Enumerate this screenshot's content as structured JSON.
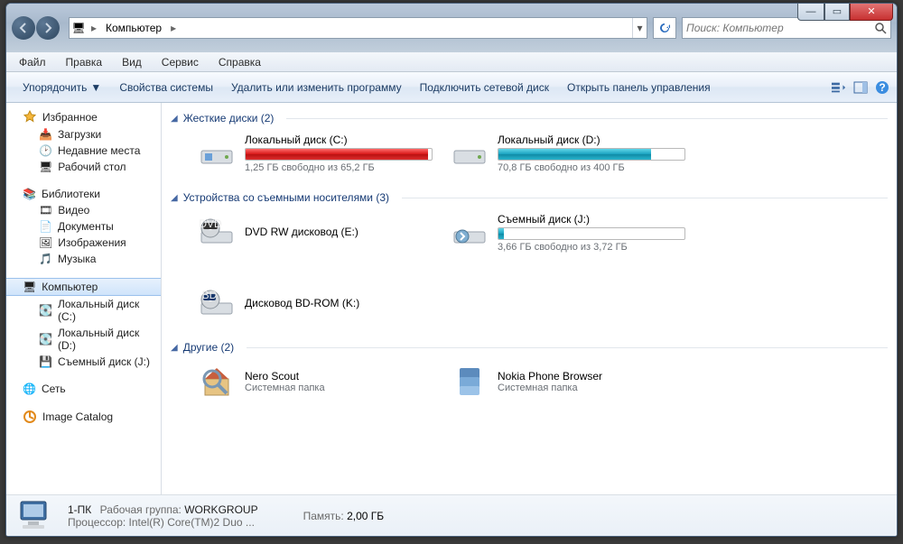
{
  "address": {
    "crumb_icon": "🖥",
    "crumb_text": "Компьютер"
  },
  "search": {
    "placeholder": "Поиск: Компьютер"
  },
  "menu": {
    "items": [
      "Файл",
      "Правка",
      "Вид",
      "Сервис",
      "Справка"
    ]
  },
  "toolbar": {
    "organize": "Упорядочить",
    "sys_props": "Свойства системы",
    "uninstall": "Удалить или изменить программу",
    "map_drive": "Подключить сетевой диск",
    "ctrl_panel": "Открыть панель управления"
  },
  "sidebar": {
    "favorites": {
      "head": "Избранное",
      "items": [
        "Загрузки",
        "Недавние места",
        "Рабочий стол"
      ]
    },
    "libraries": {
      "head": "Библиотеки",
      "items": [
        "Видео",
        "Документы",
        "Изображения",
        "Музыка"
      ]
    },
    "computer": {
      "head": "Компьютер",
      "items": [
        "Локальный диск (C:)",
        "Локальный диск (D:)",
        "Съемный диск (J:)"
      ]
    },
    "network": {
      "head": "Сеть"
    },
    "image_catalog": {
      "head": "Image Catalog"
    }
  },
  "sections": {
    "hdd": {
      "title": "Жесткие диски (2)"
    },
    "removable": {
      "title": "Устройства со съемными носителями (3)"
    },
    "other": {
      "title": "Другие (2)"
    }
  },
  "drives": {
    "c": {
      "name": "Локальный диск (C:)",
      "sub": "1,25 ГБ свободно из 65,2 ГБ",
      "fill_pct": 98,
      "fill_color": "red"
    },
    "d": {
      "name": "Локальный диск (D:)",
      "sub": "70,8 ГБ свободно из 400 ГБ",
      "fill_pct": 82,
      "fill_color": "teal"
    }
  },
  "removable": {
    "dvd": {
      "name": "DVD RW дисковод (E:)"
    },
    "usb": {
      "name": "Съемный диск (J:)",
      "sub": "3,66 ГБ свободно из 3,72 ГБ",
      "fill_pct": 3,
      "fill_color": "teal"
    },
    "bd": {
      "name": "Дисковод BD-ROM (K:)"
    }
  },
  "other": {
    "nero": {
      "name": "Nero Scout",
      "sub": "Системная папка"
    },
    "nokia": {
      "name": "Nokia Phone Browser",
      "sub": "Системная папка"
    }
  },
  "details": {
    "pc_name": "1-ПК",
    "workgroup_label": "Рабочая группа:",
    "workgroup_value": "WORKGROUP",
    "cpu_label": "Процессор:",
    "cpu_value": "Intel(R) Core(TM)2 Duo ...",
    "mem_label": "Память:",
    "mem_value": "2,00 ГБ"
  }
}
